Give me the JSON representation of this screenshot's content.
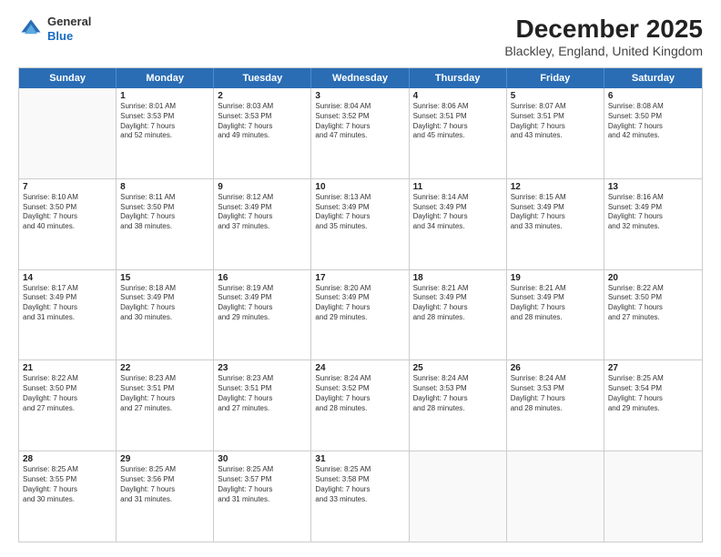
{
  "header": {
    "logo_line1": "General",
    "logo_line2": "Blue",
    "main_title": "December 2025",
    "subtitle": "Blackley, England, United Kingdom"
  },
  "days_of_week": [
    "Sunday",
    "Monday",
    "Tuesday",
    "Wednesday",
    "Thursday",
    "Friday",
    "Saturday"
  ],
  "weeks": [
    [
      {
        "day": "",
        "sunrise": "",
        "sunset": "",
        "daylight": "",
        "empty": true
      },
      {
        "day": "1",
        "sunrise": "Sunrise: 8:01 AM",
        "sunset": "Sunset: 3:53 PM",
        "daylight": "Daylight: 7 hours",
        "daylight2": "and 52 minutes.",
        "empty": false
      },
      {
        "day": "2",
        "sunrise": "Sunrise: 8:03 AM",
        "sunset": "Sunset: 3:53 PM",
        "daylight": "Daylight: 7 hours",
        "daylight2": "and 49 minutes.",
        "empty": false
      },
      {
        "day": "3",
        "sunrise": "Sunrise: 8:04 AM",
        "sunset": "Sunset: 3:52 PM",
        "daylight": "Daylight: 7 hours",
        "daylight2": "and 47 minutes.",
        "empty": false
      },
      {
        "day": "4",
        "sunrise": "Sunrise: 8:06 AM",
        "sunset": "Sunset: 3:51 PM",
        "daylight": "Daylight: 7 hours",
        "daylight2": "and 45 minutes.",
        "empty": false
      },
      {
        "day": "5",
        "sunrise": "Sunrise: 8:07 AM",
        "sunset": "Sunset: 3:51 PM",
        "daylight": "Daylight: 7 hours",
        "daylight2": "and 43 minutes.",
        "empty": false
      },
      {
        "day": "6",
        "sunrise": "Sunrise: 8:08 AM",
        "sunset": "Sunset: 3:50 PM",
        "daylight": "Daylight: 7 hours",
        "daylight2": "and 42 minutes.",
        "empty": false
      }
    ],
    [
      {
        "day": "7",
        "sunrise": "Sunrise: 8:10 AM",
        "sunset": "Sunset: 3:50 PM",
        "daylight": "Daylight: 7 hours",
        "daylight2": "and 40 minutes.",
        "empty": false
      },
      {
        "day": "8",
        "sunrise": "Sunrise: 8:11 AM",
        "sunset": "Sunset: 3:50 PM",
        "daylight": "Daylight: 7 hours",
        "daylight2": "and 38 minutes.",
        "empty": false
      },
      {
        "day": "9",
        "sunrise": "Sunrise: 8:12 AM",
        "sunset": "Sunset: 3:49 PM",
        "daylight": "Daylight: 7 hours",
        "daylight2": "and 37 minutes.",
        "empty": false
      },
      {
        "day": "10",
        "sunrise": "Sunrise: 8:13 AM",
        "sunset": "Sunset: 3:49 PM",
        "daylight": "Daylight: 7 hours",
        "daylight2": "and 35 minutes.",
        "empty": false
      },
      {
        "day": "11",
        "sunrise": "Sunrise: 8:14 AM",
        "sunset": "Sunset: 3:49 PM",
        "daylight": "Daylight: 7 hours",
        "daylight2": "and 34 minutes.",
        "empty": false
      },
      {
        "day": "12",
        "sunrise": "Sunrise: 8:15 AM",
        "sunset": "Sunset: 3:49 PM",
        "daylight": "Daylight: 7 hours",
        "daylight2": "and 33 minutes.",
        "empty": false
      },
      {
        "day": "13",
        "sunrise": "Sunrise: 8:16 AM",
        "sunset": "Sunset: 3:49 PM",
        "daylight": "Daylight: 7 hours",
        "daylight2": "and 32 minutes.",
        "empty": false
      }
    ],
    [
      {
        "day": "14",
        "sunrise": "Sunrise: 8:17 AM",
        "sunset": "Sunset: 3:49 PM",
        "daylight": "Daylight: 7 hours",
        "daylight2": "and 31 minutes.",
        "empty": false
      },
      {
        "day": "15",
        "sunrise": "Sunrise: 8:18 AM",
        "sunset": "Sunset: 3:49 PM",
        "daylight": "Daylight: 7 hours",
        "daylight2": "and 30 minutes.",
        "empty": false
      },
      {
        "day": "16",
        "sunrise": "Sunrise: 8:19 AM",
        "sunset": "Sunset: 3:49 PM",
        "daylight": "Daylight: 7 hours",
        "daylight2": "and 29 minutes.",
        "empty": false
      },
      {
        "day": "17",
        "sunrise": "Sunrise: 8:20 AM",
        "sunset": "Sunset: 3:49 PM",
        "daylight": "Daylight: 7 hours",
        "daylight2": "and 29 minutes.",
        "empty": false
      },
      {
        "day": "18",
        "sunrise": "Sunrise: 8:21 AM",
        "sunset": "Sunset: 3:49 PM",
        "daylight": "Daylight: 7 hours",
        "daylight2": "and 28 minutes.",
        "empty": false
      },
      {
        "day": "19",
        "sunrise": "Sunrise: 8:21 AM",
        "sunset": "Sunset: 3:49 PM",
        "daylight": "Daylight: 7 hours",
        "daylight2": "and 28 minutes.",
        "empty": false
      },
      {
        "day": "20",
        "sunrise": "Sunrise: 8:22 AM",
        "sunset": "Sunset: 3:50 PM",
        "daylight": "Daylight: 7 hours",
        "daylight2": "and 27 minutes.",
        "empty": false
      }
    ],
    [
      {
        "day": "21",
        "sunrise": "Sunrise: 8:22 AM",
        "sunset": "Sunset: 3:50 PM",
        "daylight": "Daylight: 7 hours",
        "daylight2": "and 27 minutes.",
        "empty": false
      },
      {
        "day": "22",
        "sunrise": "Sunrise: 8:23 AM",
        "sunset": "Sunset: 3:51 PM",
        "daylight": "Daylight: 7 hours",
        "daylight2": "and 27 minutes.",
        "empty": false
      },
      {
        "day": "23",
        "sunrise": "Sunrise: 8:23 AM",
        "sunset": "Sunset: 3:51 PM",
        "daylight": "Daylight: 7 hours",
        "daylight2": "and 27 minutes.",
        "empty": false
      },
      {
        "day": "24",
        "sunrise": "Sunrise: 8:24 AM",
        "sunset": "Sunset: 3:52 PM",
        "daylight": "Daylight: 7 hours",
        "daylight2": "and 28 minutes.",
        "empty": false
      },
      {
        "day": "25",
        "sunrise": "Sunrise: 8:24 AM",
        "sunset": "Sunset: 3:53 PM",
        "daylight": "Daylight: 7 hours",
        "daylight2": "and 28 minutes.",
        "empty": false
      },
      {
        "day": "26",
        "sunrise": "Sunrise: 8:24 AM",
        "sunset": "Sunset: 3:53 PM",
        "daylight": "Daylight: 7 hours",
        "daylight2": "and 28 minutes.",
        "empty": false
      },
      {
        "day": "27",
        "sunrise": "Sunrise: 8:25 AM",
        "sunset": "Sunset: 3:54 PM",
        "daylight": "Daylight: 7 hours",
        "daylight2": "and 29 minutes.",
        "empty": false
      }
    ],
    [
      {
        "day": "28",
        "sunrise": "Sunrise: 8:25 AM",
        "sunset": "Sunset: 3:55 PM",
        "daylight": "Daylight: 7 hours",
        "daylight2": "and 30 minutes.",
        "empty": false
      },
      {
        "day": "29",
        "sunrise": "Sunrise: 8:25 AM",
        "sunset": "Sunset: 3:56 PM",
        "daylight": "Daylight: 7 hours",
        "daylight2": "and 31 minutes.",
        "empty": false
      },
      {
        "day": "30",
        "sunrise": "Sunrise: 8:25 AM",
        "sunset": "Sunset: 3:57 PM",
        "daylight": "Daylight: 7 hours",
        "daylight2": "and 31 minutes.",
        "empty": false
      },
      {
        "day": "31",
        "sunrise": "Sunrise: 8:25 AM",
        "sunset": "Sunset: 3:58 PM",
        "daylight": "Daylight: 7 hours",
        "daylight2": "and 33 minutes.",
        "empty": false
      },
      {
        "day": "",
        "sunrise": "",
        "sunset": "",
        "daylight": "",
        "daylight2": "",
        "empty": true
      },
      {
        "day": "",
        "sunrise": "",
        "sunset": "",
        "daylight": "",
        "daylight2": "",
        "empty": true
      },
      {
        "day": "",
        "sunrise": "",
        "sunset": "",
        "daylight": "",
        "daylight2": "",
        "empty": true
      }
    ]
  ]
}
